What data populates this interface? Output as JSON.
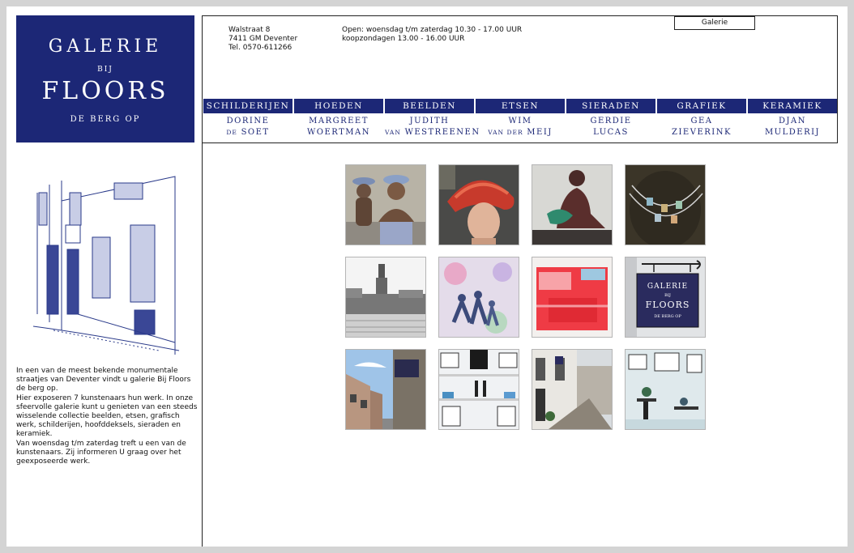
{
  "logo": {
    "line1": "GALERIE",
    "line2": "BIJ",
    "line3": "FLOORS",
    "line4": "DE BERG OP",
    "bg_color": "#1c2776"
  },
  "header": {
    "address": [
      "Walstraat 8",
      "7411 GM Deventer",
      "Tel. 0570-611266"
    ],
    "hours": [
      "Open: woensdag t/m zaterdag 10.30 - 17.00 UUR",
      "koopzondagen 13.00 - 16.00 UUR"
    ],
    "galerie_button": "Galerie"
  },
  "nav": [
    {
      "category": "SCHILDERIJEN",
      "artist_top": "DORINE",
      "artist_small": "DE",
      "artist_bottom": "SOET"
    },
    {
      "category": "HOEDEN",
      "artist_top": "MARGREET",
      "artist_small": "",
      "artist_bottom": "WOERTMAN"
    },
    {
      "category": "BEELDEN",
      "artist_top": "JUDITH",
      "artist_small": "VAN",
      "artist_bottom": "WESTREENEN"
    },
    {
      "category": "ETSEN",
      "artist_top": "WIM",
      "artist_small": "VAN DER",
      "artist_bottom": "MEIJ"
    },
    {
      "category": "SIERADEN",
      "artist_top": "GERDIE",
      "artist_small": "",
      "artist_bottom": "LUCAS"
    },
    {
      "category": "GRAFIEK",
      "artist_top": "GEA",
      "artist_small": "",
      "artist_bottom": "ZIEVERINK"
    },
    {
      "category": "KERAMIEK",
      "artist_top": "DJAN",
      "artist_small": "",
      "artist_bottom": "MULDERIJ"
    }
  ],
  "intro": [
    "In een van de meest bekende monumentale straatjes van Deventer vindt u galerie Bij Floors de berg op.",
    "Hier exposeren 7 kunstenaars hun werk. In onze sfeervolle galerie kunt u genieten van een steeds wisselende collectie beelden, etsen, grafisch werk, schilderijen, hoofddeksels, sieraden en keramiek.",
    "Van woensdag t/m zaterdag treft u een van de kunstenaars. Zij informeren U graag over het geexposeerde werk."
  ],
  "sign": {
    "line1": "GALERIE",
    "line2": "BIJ",
    "line3": "FLOORS",
    "line4": "DE BERG OP"
  },
  "colors": {
    "navy": "#1c2776",
    "page_bg": "#d4d4d4"
  }
}
